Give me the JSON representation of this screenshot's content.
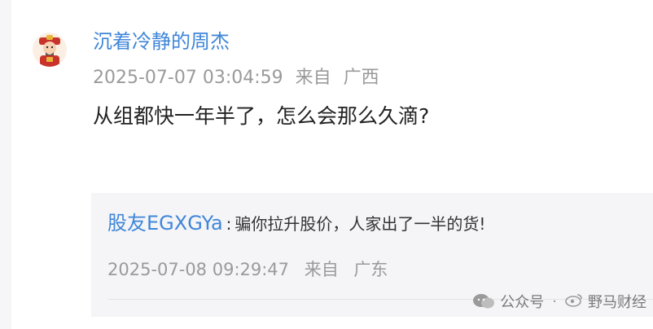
{
  "comment": {
    "username": "沉着冷静的周杰",
    "timestamp": "2025-07-07 03:04:59",
    "source_prefix": "来自",
    "location": "广西",
    "text": "从组都快一年半了，怎么会那么久滴?"
  },
  "reply": {
    "username": "股友EGXGYa",
    "separator": ":",
    "text": "骗你拉升股价，人家出了一半的货!",
    "timestamp": "2025-07-08 09:29:47",
    "source_prefix": "来自",
    "location": "广东"
  },
  "watermark": {
    "icon": "wechat-icon",
    "account_label": "公众号",
    "dot": "·",
    "name": "野马财经",
    "overlay_icon": "weibo-icon"
  },
  "colors": {
    "link_blue": "#3f86d9",
    "meta_gray": "#9a9a9a",
    "reply_bg": "#f5f5f7"
  }
}
